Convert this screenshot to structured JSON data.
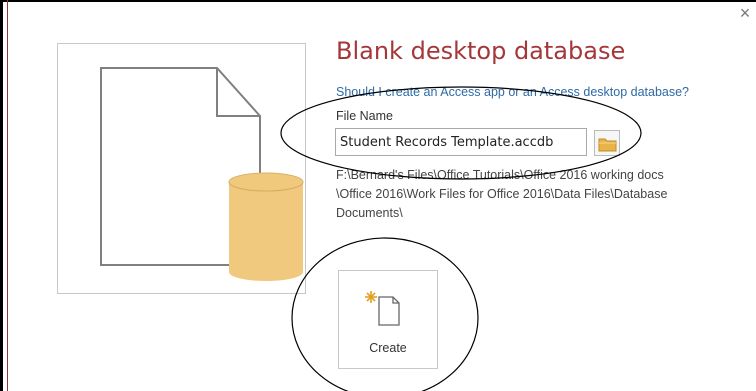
{
  "dialog": {
    "title": "Blank desktop database",
    "help_link": "Should I create an Access app or an Access desktop database?",
    "file_name_label": "File Name",
    "file_name_value": "Student Records Template.accdb",
    "path_line_1": "F:\\Bernard's Files\\Office Tutorials\\Office 2016 working docs",
    "path_line_2": "\\Office 2016\\Work Files for Office 2016\\Data Files\\Database",
    "path_line_3": "Documents\\",
    "create_label": "Create",
    "close_glyph": "×"
  },
  "icons": {
    "close": "close-icon",
    "browse": "folder-icon",
    "create": "new-document-sparkle-icon",
    "preview": "blank-database-icon"
  },
  "colors": {
    "title": "#a4373a",
    "link": "#2e6aa6",
    "database_fill": "#f1c97e",
    "folder_fill": "#e8b44a"
  }
}
